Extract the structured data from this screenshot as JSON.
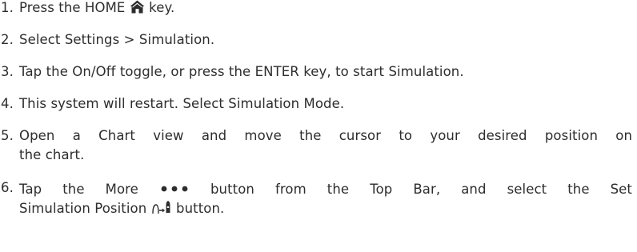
{
  "steps": [
    {
      "number": "1.",
      "text_before": "Press the HOME",
      "icon": "home-icon",
      "text_after": "key."
    },
    {
      "number": "2.",
      "text": "Select Settings > Simulation."
    },
    {
      "number": "3.",
      "text": "Tap the On/Off toggle, or press the ENTER key, to start Simulation."
    },
    {
      "number": "4.",
      "text": "This system will restart. Select Simulation Mode."
    },
    {
      "number": "5.",
      "line1": "Open a Chart view and move the cursor to your desired position on",
      "line2": "the chart."
    },
    {
      "number": "6.",
      "line1_before": "Tap the More",
      "line1_icon": "more-dots-icon",
      "line1_after": "button from the Top Bar, and select the Set",
      "line2_before": "Simulation Position",
      "line2_icon": "set-simulation-position-icon",
      "line2_after": "button."
    }
  ]
}
